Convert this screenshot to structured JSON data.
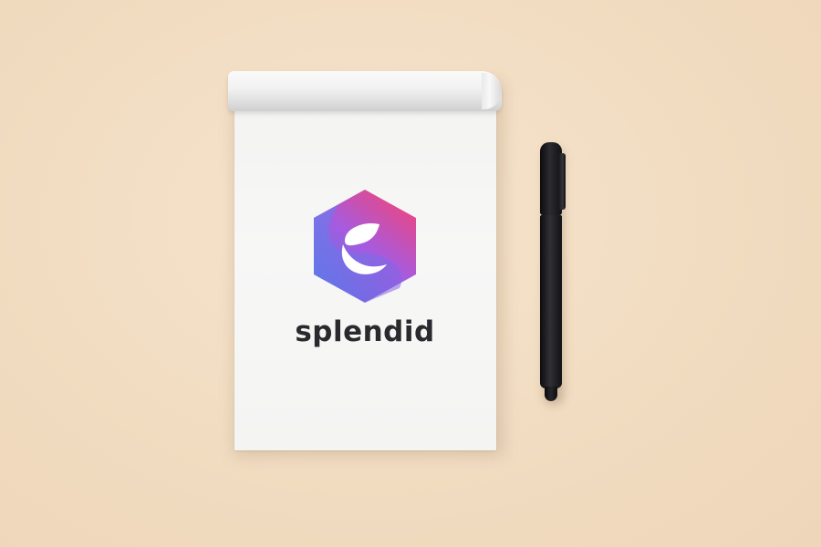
{
  "brand": {
    "name": "splendid",
    "logo_gradient": [
      "#f0457a",
      "#a65be0",
      "#4a7be6"
    ]
  },
  "scene": {
    "background_color": "#f2dec4",
    "notepad_color": "#f5f5f4",
    "pen_color": "#1a1a1d"
  }
}
